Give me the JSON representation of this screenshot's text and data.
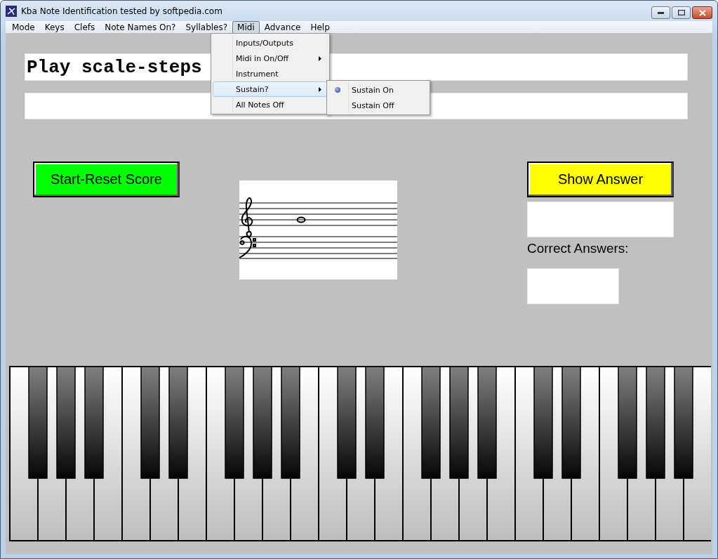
{
  "window": {
    "title": "Kba Note Identification tested by softpedia.com"
  },
  "menu_bar": [
    {
      "label": "Mode",
      "selected": false
    },
    {
      "label": "Keys",
      "selected": false
    },
    {
      "label": "Clefs",
      "selected": false
    },
    {
      "label": "Note Names On?",
      "selected": false
    },
    {
      "label": "Syllables?",
      "selected": false
    },
    {
      "label": "Midi",
      "selected": true
    },
    {
      "label": "Advance",
      "selected": false
    },
    {
      "label": "Help",
      "selected": false
    }
  ],
  "midi_menu": [
    {
      "label": "Inputs/Outputs",
      "submenu": false,
      "selected": false
    },
    {
      "label": "Midi in On/Off",
      "submenu": true,
      "selected": false
    },
    {
      "label": "Instrument",
      "submenu": false,
      "selected": false
    },
    {
      "label": "Sustain?",
      "submenu": true,
      "selected": true
    },
    {
      "label": "All Notes Off",
      "submenu": false,
      "selected": false
    }
  ],
  "sustain_submenu": [
    {
      "label": "Sustain On",
      "checked": true
    },
    {
      "label": "Sustain Off",
      "checked": false
    }
  ],
  "prompt": {
    "value": "Play scale-steps"
  },
  "start_reset_button": "Start-Reset Score",
  "show_answer_button": "Show Answer",
  "correct_answers_label": "Correct Answers:"
}
